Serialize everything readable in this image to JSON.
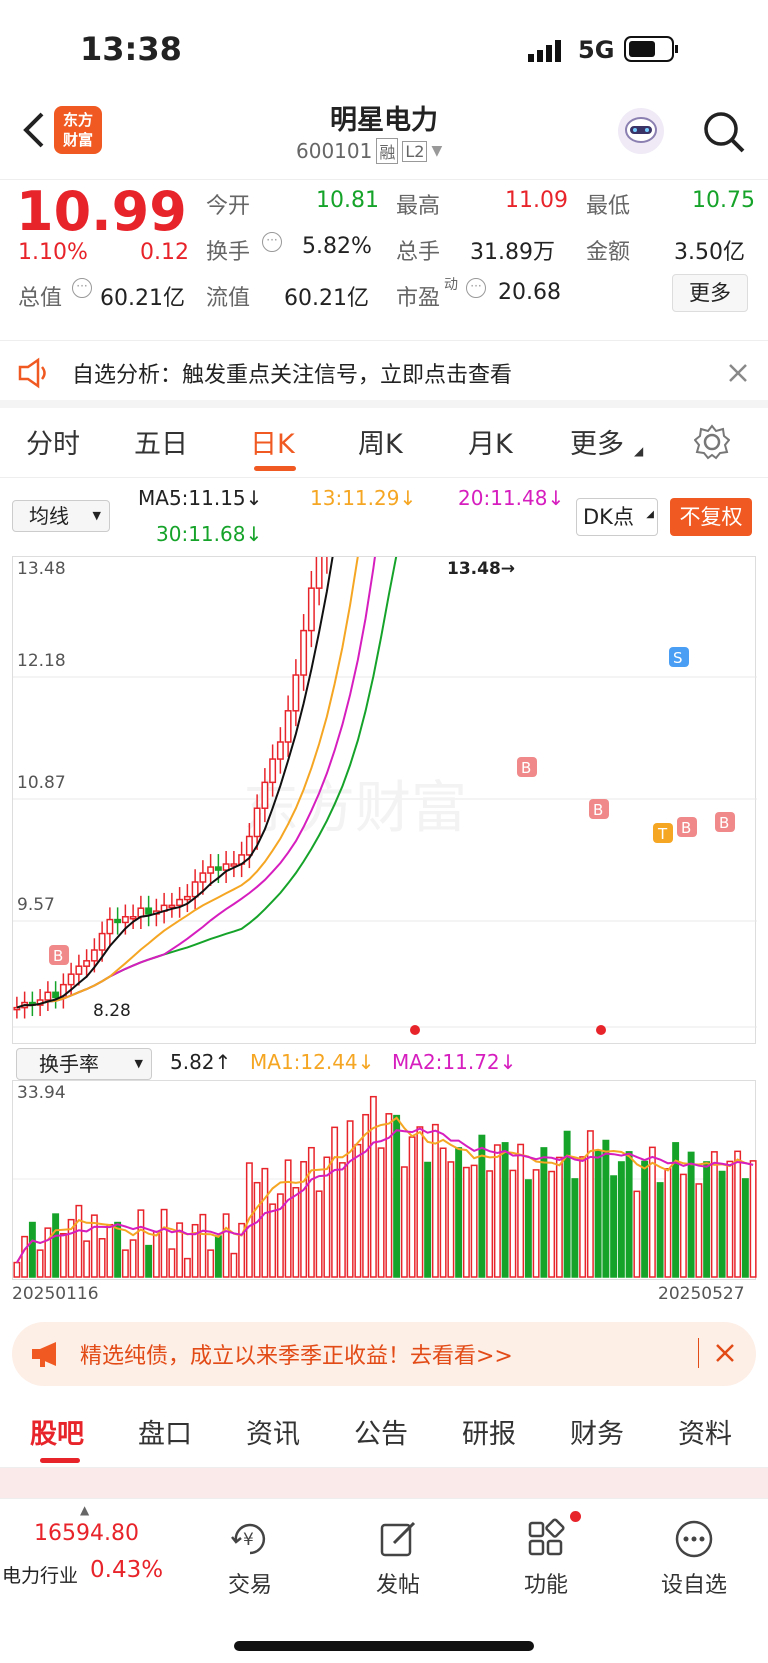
{
  "status_bar": {
    "time": "13:38",
    "network": "5G"
  },
  "header": {
    "title": "明星电力",
    "code": "600101",
    "badge1": "融",
    "badge2": "L2",
    "logo_line1": "东方",
    "logo_line2": "财富"
  },
  "quote": {
    "price": "10.99",
    "pct": "1.10%",
    "chg": "0.12",
    "open_label": "今开",
    "open": "10.81",
    "high_label": "最高",
    "high": "11.09",
    "low_label": "最低",
    "low": "10.75",
    "turnover_label": "换手",
    "turnover": "5.82%",
    "vol_label": "总手",
    "vol": "31.89万",
    "amount_label": "金额",
    "amount": "3.50亿",
    "mktcap_label": "总值",
    "mktcap": "60.21亿",
    "float_label": "流值",
    "float": "60.21亿",
    "pe_label": "市盈",
    "pe_sup": "动",
    "pe": "20.68",
    "more": "更多"
  },
  "banner": {
    "text": "自选分析：触发重点关注信号，立即点击查看"
  },
  "tabs": [
    "分时",
    "五日",
    "日K",
    "周K",
    "月K",
    "更多"
  ],
  "ma": {
    "selector": "均线",
    "ma5": "MA5:11.15↓",
    "ma13": "13:11.29↓",
    "ma20": "20:11.48↓",
    "ma30": "30:11.68↓",
    "dk": "DK点",
    "fq": "不复权"
  },
  "chart_labels": {
    "y1": "13.48",
    "y2": "12.18",
    "y3": "10.87",
    "y4": "9.57",
    "peak": "13.48→",
    "low": "8.28",
    "signal_b": "B",
    "signal_s": "S",
    "signal_t": "T",
    "watermark": "东方财富"
  },
  "volume": {
    "selector": "换手率",
    "val": "5.82↑",
    "ma1": "MA1:12.44↓",
    "ma2": "MA2:11.72↓",
    "top": "33.94",
    "date_start": "20250116",
    "date_end": "20250527"
  },
  "ad": {
    "text": "精选纯债，成立以来季季正收益！去看看>>"
  },
  "bottom_tabs": [
    "股吧",
    "盘口",
    "资讯",
    "公告",
    "研报",
    "财务",
    "资料"
  ],
  "bottom_nav": {
    "index_value": "16594.80",
    "index_name": "电力行业",
    "index_pct": "0.43%",
    "items": [
      "交易",
      "发帖",
      "功能",
      "设自选"
    ]
  },
  "colors": {
    "up": "#e8242b",
    "down": "#16a32a",
    "accent": "#f05a22"
  }
}
